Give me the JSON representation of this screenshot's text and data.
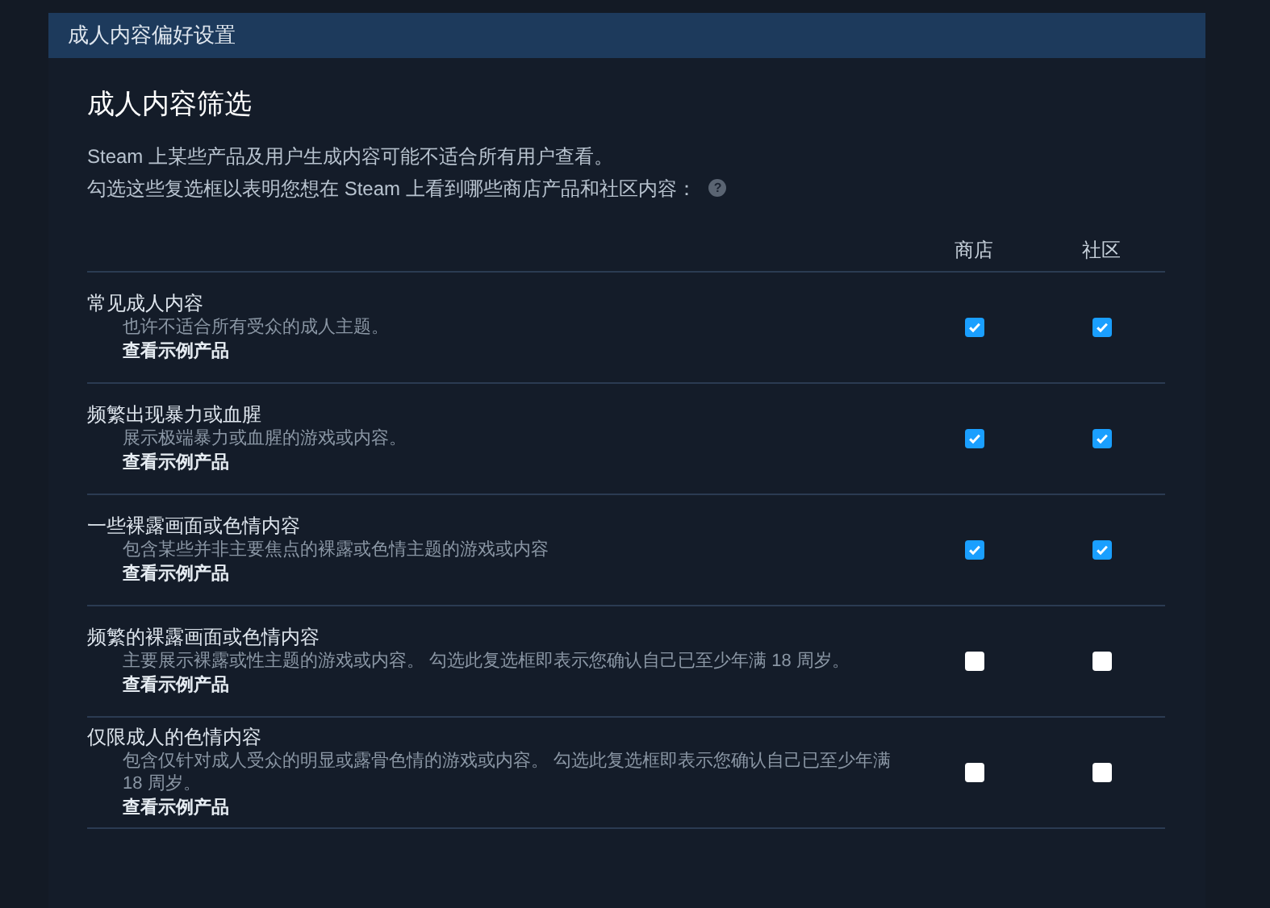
{
  "panel": {
    "title": "成人内容偏好设置"
  },
  "heading": "成人内容筛选",
  "intro": [
    "Steam 上某些产品及用户生成内容可能不适合所有用户查看。",
    "勾选这些复选框以表明您想在 Steam 上看到哪些商店产品和社区内容："
  ],
  "help_icon": "?",
  "columns": [
    "商店",
    "社区"
  ],
  "rows": [
    {
      "title": "常见成人内容",
      "description": "也许不适合所有受众的成人主题。",
      "link": "查看示例产品",
      "store_checked": true,
      "community_checked": true
    },
    {
      "title": "频繁出现暴力或血腥",
      "description": "展示极端暴力或血腥的游戏或内容。",
      "link": "查看示例产品",
      "store_checked": true,
      "community_checked": true
    },
    {
      "title": "一些裸露画面或色情内容",
      "description": "包含某些并非主要焦点的裸露或色情主题的游戏或内容",
      "link": "查看示例产品",
      "store_checked": true,
      "community_checked": true
    },
    {
      "title": "频繁的裸露画面或色情内容",
      "description": "主要展示裸露或性主题的游戏或内容。 勾选此复选框即表示您确认自己已至少年满 18 周岁。",
      "link": "查看示例产品",
      "store_checked": false,
      "community_checked": false
    },
    {
      "title": "仅限成人的色情内容",
      "description": "包含仅针对成人受众的明显或露骨色情的游戏或内容。 勾选此复选框即表示您确认自己已至少年满 18 周岁。",
      "link": "查看示例产品",
      "store_checked": false,
      "community_checked": false
    }
  ]
}
